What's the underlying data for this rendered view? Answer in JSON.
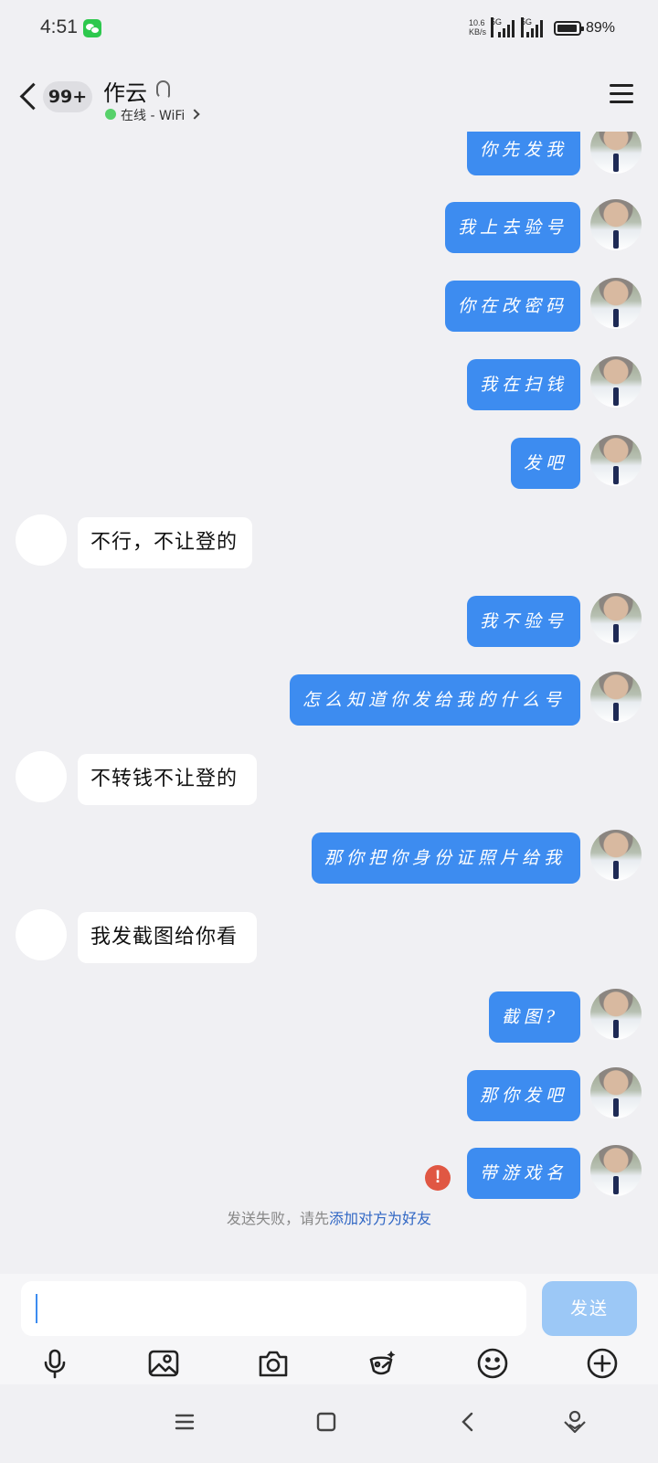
{
  "status_bar": {
    "time": "4:51",
    "net_speed_value": "10.6",
    "net_speed_unit": "KB/s",
    "signal_1_label": "5G",
    "signal_2_label": "5G",
    "battery": "89%"
  },
  "header": {
    "unread_count": "99+",
    "contact_name": "作云",
    "online_status": "在线 - WiFi"
  },
  "messages": [
    {
      "side": "self",
      "text": "你先发我"
    },
    {
      "side": "self",
      "text": "我上去验号"
    },
    {
      "side": "self",
      "text": "你在改密码"
    },
    {
      "side": "self",
      "text": "我在扫钱"
    },
    {
      "side": "self",
      "text": "发吧"
    },
    {
      "side": "other",
      "text": "不行，不让登的"
    },
    {
      "side": "self",
      "text": "我不验号"
    },
    {
      "side": "self",
      "text": "怎么知道你发给我的什么号"
    },
    {
      "side": "other",
      "text": "不转钱不让登的"
    },
    {
      "side": "self",
      "text": "那你把你身份证照片给我"
    },
    {
      "side": "other",
      "text": "我发截图给你看"
    },
    {
      "side": "self",
      "text": "截图?"
    },
    {
      "side": "self",
      "text": "那你发吧"
    },
    {
      "side": "self",
      "text": "带游戏名",
      "failed": true
    }
  ],
  "notice": {
    "prefix": "发送失败，请先",
    "link": "添加对方为好友"
  },
  "input": {
    "value": "",
    "send_label": "发送"
  },
  "toolbar_icons": [
    "microphone-icon",
    "image-icon",
    "camera-icon",
    "magic-icon",
    "emoji-icon",
    "plus-icon"
  ],
  "colors": {
    "self_bubble": "#3d8cf0",
    "other_bubble": "#ffffff",
    "background": "#f0f0f3",
    "send_button": "#9cc8f6",
    "error": "#e05743",
    "online": "#57d16a"
  }
}
